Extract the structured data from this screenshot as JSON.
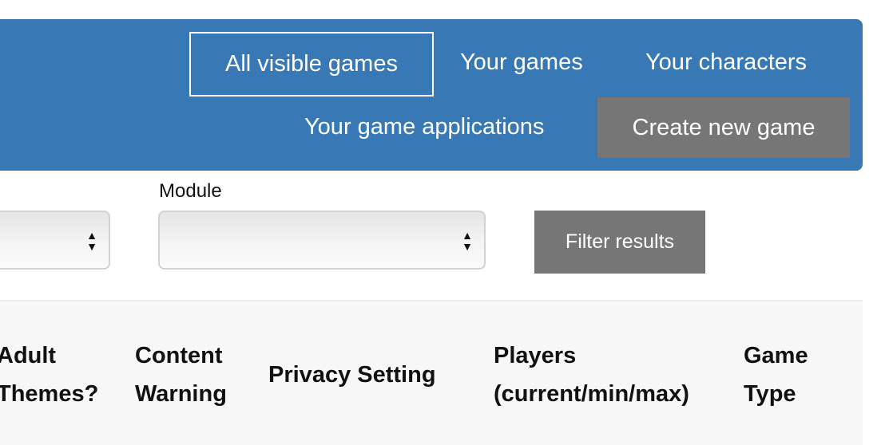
{
  "nav": {
    "all_visible_games": "All visible games",
    "your_games": "Your games",
    "your_characters": "Your characters",
    "your_game_applications": "Your game applications",
    "create_new_game": "Create new game"
  },
  "filters": {
    "module_label": "Module",
    "filter_button": "Filter results"
  },
  "table": {
    "headers": [
      "Adult Themes?",
      "Content Warning",
      "Privacy Setting",
      "Players (current/min/max)",
      "Game Type"
    ],
    "header_lines": [
      [
        "Adult",
        "Themes?"
      ],
      [
        "Content",
        "Warning"
      ],
      [
        "Privacy Setting"
      ],
      [
        "Players",
        "(current/min/max)"
      ],
      [
        "Game",
        "Type"
      ]
    ]
  },
  "colors": {
    "nav_bg": "#3778b5",
    "button_bg": "#767676"
  }
}
